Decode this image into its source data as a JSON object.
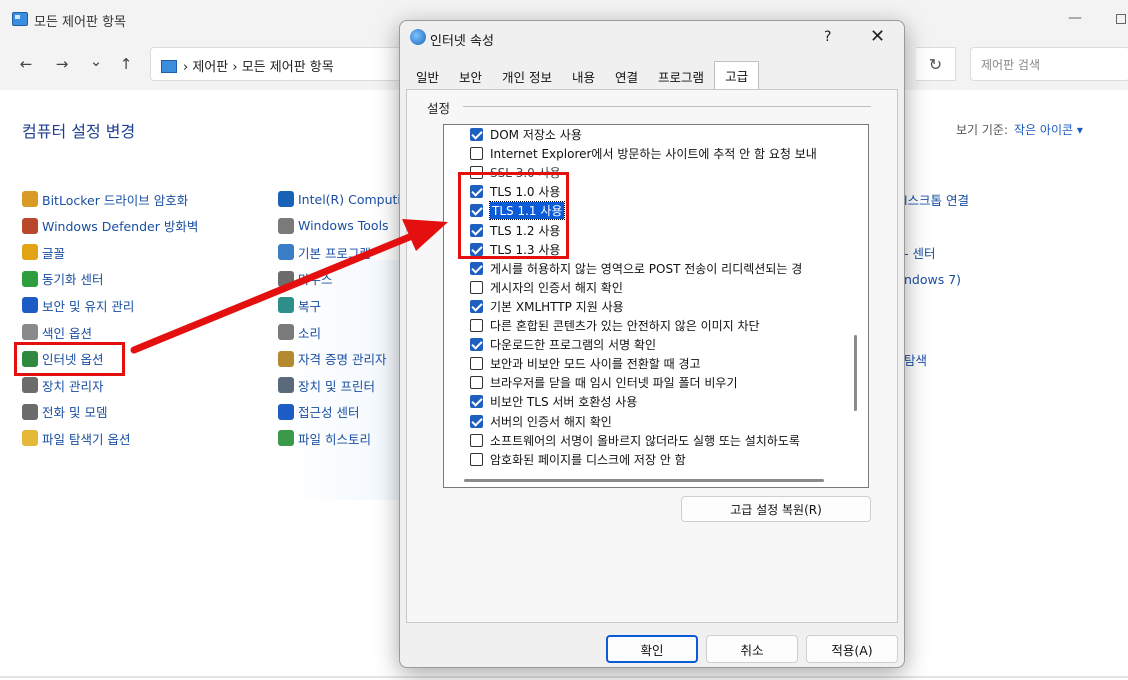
{
  "control_panel": {
    "window_title": "모든 제어판 항목",
    "nav": {
      "back": "←",
      "forward": "→",
      "dropdown": "⌄",
      "up": "↑",
      "refresh": "↻"
    },
    "address": {
      "crumb1": "제어판",
      "sep": "›",
      "crumb2": "모든 제어판 항목"
    },
    "search_placeholder": "제어판 검색",
    "heading": "컴퓨터 설정 변경",
    "view_by_label": "보기 기준:",
    "view_by_value": "작은 아이콘 ▾",
    "col1": [
      {
        "label": "BitLocker 드라이브 암호화",
        "icon": "bitlocker-icon",
        "color": "#d99a26"
      },
      {
        "label": "Windows Defender 방화벽",
        "icon": "firewall-icon",
        "color": "#b8472c"
      },
      {
        "label": "글꼴",
        "icon": "font-icon",
        "color": "#e0a416"
      },
      {
        "label": "동기화 센터",
        "icon": "sync-icon",
        "color": "#2e9e3e"
      },
      {
        "label": "보안 및 유지 관리",
        "icon": "flag-icon",
        "color": "#1d5cc4"
      },
      {
        "label": "색인 옵션",
        "icon": "index-icon",
        "color": "#8a8a8a"
      },
      {
        "label": "인터넷 옵션",
        "icon": "internet-options-icon",
        "color": "#2f8a3f"
      },
      {
        "label": "장치 관리자",
        "icon": "device-manager-icon",
        "color": "#6c6c6c"
      },
      {
        "label": "전화 및 모뎀",
        "icon": "phone-icon",
        "color": "#6c6c6c"
      },
      {
        "label": "파일 탐색기 옵션",
        "icon": "folder-icon",
        "color": "#e6b838"
      }
    ],
    "col2": [
      {
        "label": "Intel(R) Computin",
        "icon": "intel-icon",
        "color": "#1a62b8"
      },
      {
        "label": "Windows Tools",
        "icon": "tools-icon",
        "color": "#7a7a7a"
      },
      {
        "label": "기본 프로그램",
        "icon": "default-programs-icon",
        "color": "#3a7ec8"
      },
      {
        "label": "마우스",
        "icon": "mouse-icon",
        "color": "#6c6c6c"
      },
      {
        "label": "복구",
        "icon": "recovery-icon",
        "color": "#2e8f8a"
      },
      {
        "label": "소리",
        "icon": "speaker-icon",
        "color": "#7a7a7a"
      },
      {
        "label": "자격 증명 관리자",
        "icon": "credential-icon",
        "color": "#b48a30"
      },
      {
        "label": "장치 및 프린터",
        "icon": "printer-icon",
        "color": "#5a6a7a"
      },
      {
        "label": "접근성 센터",
        "icon": "accessibility-icon",
        "color": "#1d5cc4"
      },
      {
        "label": "파일 히스토리",
        "icon": "file-history-icon",
        "color": "#3a9a4a"
      }
    ],
    "col4": [
      {
        "label": "l스크톱 연결"
      },
      {
        "label": "- 센터"
      },
      {
        "label": "ndows 7)"
      },
      {
        "label": "탐색"
      }
    ]
  },
  "dialog": {
    "title": "인터넷 속성",
    "help": "?",
    "close": "✕",
    "tabs": [
      "일반",
      "보안",
      "개인 정보",
      "내용",
      "연결",
      "프로그램",
      "고급"
    ],
    "active_tab": "고급",
    "group_label": "설정",
    "settings": [
      {
        "label": "DOM 저장소 사용",
        "checked": true
      },
      {
        "label": "Internet Explorer에서 방문하는 사이트에 추적 안 함 요청 보내",
        "checked": false
      },
      {
        "label": "SSL 3.0 사용",
        "checked": false,
        "obscured": true
      },
      {
        "label": "TLS 1.0 사용",
        "checked": true
      },
      {
        "label": "TLS 1.1 사용",
        "checked": true,
        "selected": true
      },
      {
        "label": "TLS 1.2 사용",
        "checked": true
      },
      {
        "label": "TLS 1.3 사용",
        "checked": true
      },
      {
        "label": "게시를 허용하지 않는 영역으로 POST 전송이 리디렉션되는 경",
        "checked": true
      },
      {
        "label": "게시자의 인증서 해지 확인",
        "checked": false
      },
      {
        "label": "기본 XMLHTTP 지원 사용",
        "checked": true
      },
      {
        "label": "다른 혼합된 콘텐츠가 있는 안전하지 않은 이미지 차단",
        "checked": false
      },
      {
        "label": "다운로드한 프로그램의 서명 확인",
        "checked": true
      },
      {
        "label": "보안과 비보안 모드 사이를 전환할 때 경고",
        "checked": false
      },
      {
        "label": "브라우저를 닫을 때 임시 인터넷 파일 폴더 비우기",
        "checked": false
      },
      {
        "label": "비보안 TLS 서버 호환성 사용",
        "checked": true
      },
      {
        "label": "서버의 인증서 해지 확인",
        "checked": true
      },
      {
        "label": "소프트웨어의 서명이 올바르지 않더라도 실행 또는 설치하도록",
        "checked": false
      },
      {
        "label": "암호화된 페이지를 디스크에 저장 안 함",
        "checked": false
      }
    ],
    "restore_button": "고급 설정 복원(R)",
    "ok_button": "확인",
    "cancel_button": "취소",
    "apply_button": "적용(A)"
  },
  "annotation_color": "#e41010"
}
